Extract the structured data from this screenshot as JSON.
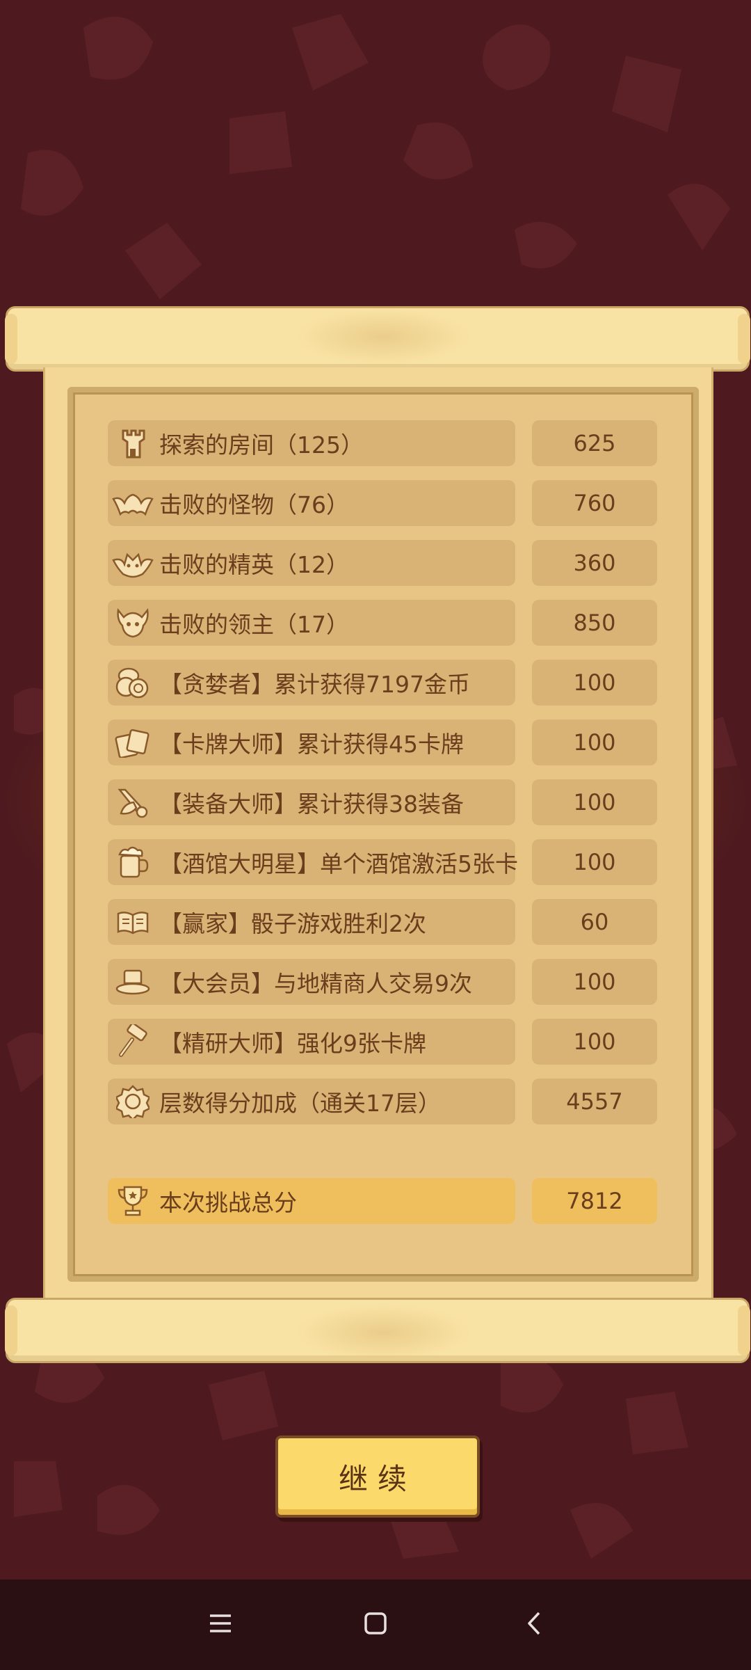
{
  "rows": [
    {
      "label": "探索的房间（125）",
      "value": "625",
      "icon": "tower-icon"
    },
    {
      "label": "击败的怪物（76）",
      "value": "760",
      "icon": "bat-icon"
    },
    {
      "label": "击败的精英（12）",
      "value": "360",
      "icon": "elite-demon-icon"
    },
    {
      "label": "击败的领主（17）",
      "value": "850",
      "icon": "boss-skull-icon"
    },
    {
      "label": "【贪婪者】累计获得7197金币",
      "value": "100",
      "icon": "coins-icon"
    },
    {
      "label": "【卡牌大师】累计获得45卡牌",
      "value": "100",
      "icon": "cards-icon"
    },
    {
      "label": "【装备大师】累计获得38装备",
      "value": "100",
      "icon": "equipment-icon"
    },
    {
      "label": "【酒馆大明星】单个酒馆激活5张卡",
      "value": "100",
      "icon": "beer-mug-icon"
    },
    {
      "label": "【赢家】骰子游戏胜利2次",
      "value": "60",
      "icon": "book-icon"
    },
    {
      "label": "【大会员】与地精商人交易9次",
      "value": "100",
      "icon": "top-hat-icon"
    },
    {
      "label": "【精研大师】强化9张卡牌",
      "value": "100",
      "icon": "hammer-icon"
    },
    {
      "label": "层数得分加成（通关17层）",
      "value": "4557",
      "icon": "floor-badge-icon"
    }
  ],
  "total": {
    "label": "本次挑战总分",
    "value": "7812",
    "icon": "trophy-icon"
  },
  "continue_label": "继续",
  "colors": {
    "background": "#4f1a1f",
    "paper": "#f3d796",
    "row": "#d9b376",
    "total_row": "#f0bf5d",
    "text": "#6a3e1c"
  }
}
